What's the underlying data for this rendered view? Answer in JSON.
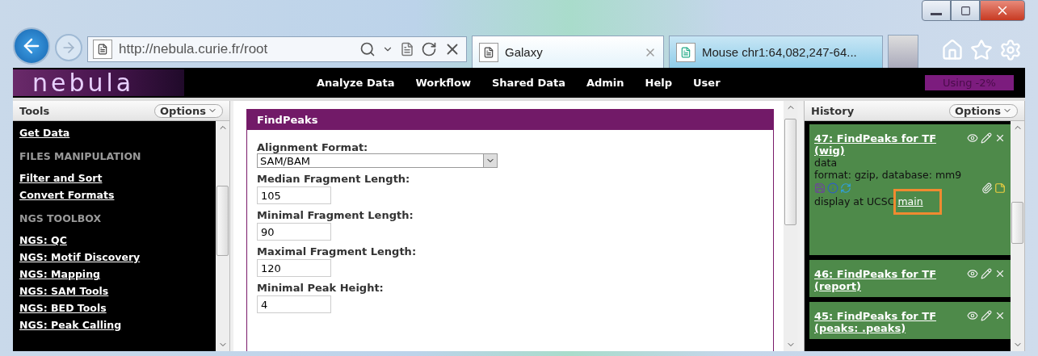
{
  "browser": {
    "url": "http://nebula.curie.fr/root",
    "tabs": [
      {
        "label": "Galaxy",
        "selected": true,
        "closable": true
      },
      {
        "label": "Mouse chr1:64,082,247-64...",
        "selected": false,
        "closable": false
      }
    ]
  },
  "masthead": {
    "logo": "nebula",
    "menu": [
      "Analyze Data",
      "Workflow",
      "Shared Data",
      "Admin",
      "Help",
      "User"
    ],
    "usage": "Using -2%"
  },
  "tools": {
    "title": "Tools",
    "options": "Options",
    "items": [
      {
        "kind": "link",
        "label": "Get Data"
      },
      {
        "kind": "section",
        "label": "FILES MANIPULATION"
      },
      {
        "kind": "link",
        "label": "Filter and Sort"
      },
      {
        "kind": "link",
        "label": "Convert Formats"
      },
      {
        "kind": "section",
        "label": "NGS TOOLBOX"
      },
      {
        "kind": "link",
        "label": "NGS: QC"
      },
      {
        "kind": "link",
        "label": "NGS: Motif Discovery"
      },
      {
        "kind": "link",
        "label": "NGS: Mapping"
      },
      {
        "kind": "link",
        "label": "NGS: SAM Tools"
      },
      {
        "kind": "link",
        "label": "NGS: BED Tools"
      },
      {
        "kind": "link",
        "label": "NGS: Peak Calling"
      }
    ]
  },
  "tool_form": {
    "title": "FindPeaks",
    "fields": [
      {
        "kind": "select",
        "label": "Alignment Format:",
        "value": "SAM/BAM"
      },
      {
        "kind": "text",
        "label": "Median Fragment Length:",
        "value": "105"
      },
      {
        "kind": "text",
        "label": "Minimal Fragment Length:",
        "value": "90"
      },
      {
        "kind": "text",
        "label": "Maximal Fragment Length:",
        "value": "120"
      },
      {
        "kind": "text",
        "label": "Minimal Peak Height:",
        "value": "4"
      }
    ]
  },
  "history": {
    "title": "History",
    "options": "Options",
    "datasets": [
      {
        "title": "47: FindPeaks for TF (wig)",
        "expanded": true,
        "info": "data",
        "meta": "format: gzip, database: mm9",
        "display": "display at UCSC",
        "display_link": "main",
        "highlighted": true
      },
      {
        "title": "46: FindPeaks for TF (report)",
        "expanded": false
      },
      {
        "title": "45: FindPeaks for TF (peaks: .peaks)",
        "expanded": false
      }
    ]
  }
}
